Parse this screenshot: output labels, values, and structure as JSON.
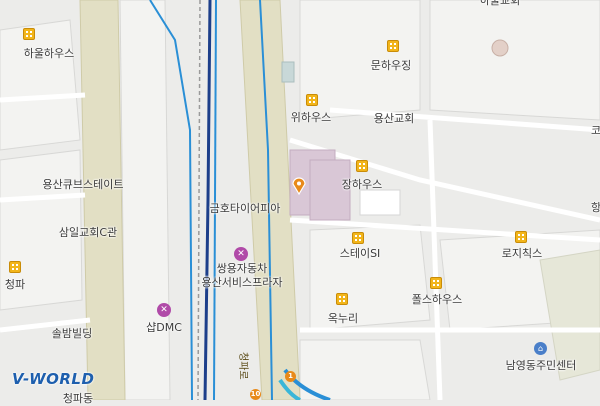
{
  "map": {
    "labels": [
      {
        "id": "haul-house",
        "text": "하울하우스"
      },
      {
        "id": "hauldaehak-partial",
        "text": "하울교회"
      },
      {
        "id": "munha-ujing",
        "text": "문하우징"
      },
      {
        "id": "wi-house",
        "text": "위하우스"
      },
      {
        "id": "yongsan-church",
        "text": "용산교회"
      },
      {
        "id": "yongsan-cube-state",
        "text": "용산큐브스테이트"
      },
      {
        "id": "jang-house",
        "text": "장하우스"
      },
      {
        "id": "kumho-tire",
        "text": "금호타이어피아"
      },
      {
        "id": "samil-church",
        "text": "삼일교회C관"
      },
      {
        "id": "stay-si",
        "text": "스테이SI"
      },
      {
        "id": "rosy-chicks",
        "text": "로지칙스"
      },
      {
        "id": "ssangyong-service",
        "text": "쌍용자동차\n용산서비스프라자"
      },
      {
        "id": "cheongpa",
        "text": "청파"
      },
      {
        "id": "fools-house",
        "text": "폴스하우스"
      },
      {
        "id": "shop-dmc",
        "text": "샵DMC"
      },
      {
        "id": "oknuri",
        "text": "옥누리"
      },
      {
        "id": "solbam-building",
        "text": "솔밤빌딩"
      },
      {
        "id": "namyeong-center",
        "text": "남영동주민센터"
      },
      {
        "id": "cheongpa-dong",
        "text": "청파동"
      },
      {
        "id": "ko-partial",
        "text": "코"
      },
      {
        "id": "hang-partial",
        "text": "항"
      }
    ],
    "road_label": "청파로",
    "road_shields": [
      "1",
      "10"
    ],
    "logo": "V-WORLD",
    "colors": {
      "background": "#ececea",
      "block": "#f7f7f5",
      "major_road": "#e2dfc4",
      "route_blue": "#2a8fd6",
      "route_navy": "#1d3f8a",
      "building": "#d9c7d6",
      "poi_building": "#f2b51a",
      "poi_shop": "#b04aa8",
      "pin": "#e88a1a"
    }
  }
}
